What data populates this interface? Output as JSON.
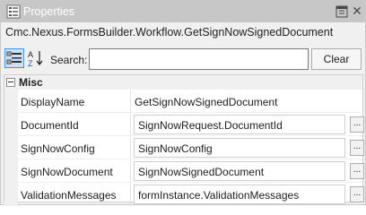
{
  "window": {
    "title": "Properties",
    "colors": {
      "titlebar": "#c7c7c7",
      "accent": "#3399ff"
    }
  },
  "object_name": "Cmc.Nexus.FormsBuilder.Workflow.GetSignNowSignedDocument",
  "toolbar": {
    "categorized_icon": "categorized-view-icon",
    "alphabetical_icon": "sort-az-icon",
    "search_label": "Search:",
    "search_value": "",
    "search_placeholder": "",
    "clear_label": "Clear"
  },
  "grid": {
    "category": "Misc",
    "properties": [
      {
        "name": "DisplayName",
        "value": "GetSignNowSignedDocument",
        "editable": false
      },
      {
        "name": "DocumentId",
        "value": "SignNowRequest.DocumentId",
        "editable": true
      },
      {
        "name": "SignNowConfig",
        "value": "SignNowConfig",
        "editable": true
      },
      {
        "name": "SignNowDocument",
        "value": "SignNowSignedDocument",
        "editable": true
      },
      {
        "name": "ValidationMessages",
        "value": "formInstance.ValidationMessages",
        "editable": true
      }
    ],
    "ellipsis_label": "..."
  }
}
